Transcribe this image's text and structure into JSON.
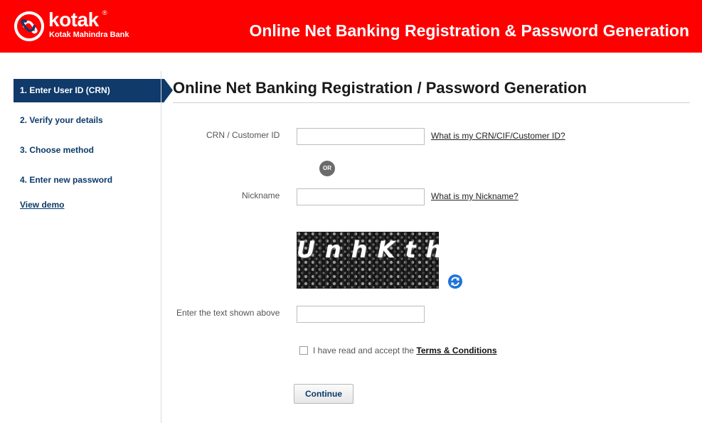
{
  "brand": {
    "name": "kotak",
    "registered_mark": "®",
    "subtitle": "Kotak Mahindra Bank",
    "color": "#ff0000"
  },
  "header": {
    "title": "Online Net Banking Registration & Password Generation"
  },
  "sidebar": {
    "steps": [
      {
        "label": "1. Enter User ID (CRN)",
        "active": true
      },
      {
        "label": "2. Verify your details",
        "active": false
      },
      {
        "label": "3. Choose method",
        "active": false
      },
      {
        "label": "4. Enter new password",
        "active": false
      }
    ],
    "demo_link": "View demo",
    "active_color": "#0f3a6a"
  },
  "main": {
    "title": "Online Net Banking Registration / Password Generation"
  },
  "form": {
    "crn": {
      "label": "CRN / Customer ID",
      "value": "",
      "help": "What is my CRN/CIF/Customer ID?"
    },
    "or_label": "OR",
    "nickname": {
      "label": "Nickname",
      "value": "",
      "help": "What is my Nickname?"
    },
    "captcha": {
      "text": "UnhKthf",
      "refresh_icon": "refresh-icon",
      "input_label": "Enter the text shown above",
      "value": ""
    },
    "terms": {
      "checked": false,
      "prefix": "I have read and accept the ",
      "link": "Terms & Conditions"
    },
    "continue_label": "Continue"
  }
}
